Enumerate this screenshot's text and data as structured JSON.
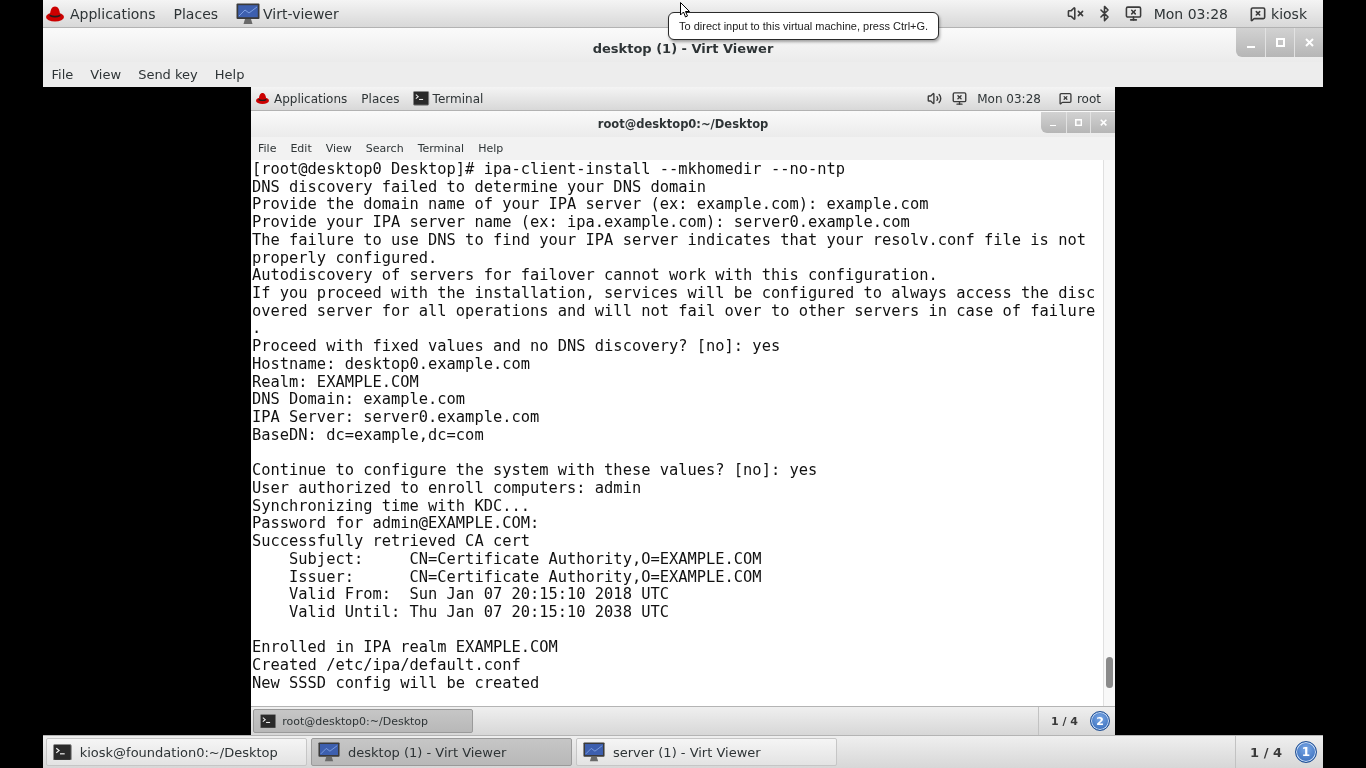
{
  "host_top_bar": {
    "menus": [
      "Applications",
      "Places"
    ],
    "app": {
      "kind": "viewer",
      "label": "Virt-viewer"
    },
    "clock": "Mon 03:28",
    "user": "kiosk"
  },
  "tooltip": {
    "text": "To direct input to this virtual machine, press Ctrl+G."
  },
  "viewer_window": {
    "title": "desktop (1) - Virt Viewer",
    "menu": [
      "File",
      "View",
      "Send key",
      "Help"
    ]
  },
  "guest": {
    "top_bar": {
      "menus": [
        "Applications",
        "Places"
      ],
      "app": {
        "kind": "terminal",
        "label": "Terminal"
      },
      "clock": "Mon 03:28",
      "user": "root"
    },
    "terminal_window": {
      "title": "root@desktop0:~/Desktop",
      "menu": [
        "File",
        "Edit",
        "View",
        "Search",
        "Terminal",
        "Help"
      ],
      "output": [
        [
          "[root@desktop0 Desktop]# ipa-client-install --mkhomedir --no-ntp",
          "DNS discovery failed to determine your DNS domain",
          "Provide the domain name of your IPA server (ex: example.com): example.com",
          "Provide your IPA server name (ex: ipa.example.com): server0.example.com",
          "The failure to use DNS to find your IPA server indicates that your resolv.conf file is not",
          "properly configured.",
          "Autodiscovery of servers for failover cannot work with this configuration.",
          "If you proceed with the installation, services will be configured to always access the disc",
          "overed server for all operations and will not fail over to other servers in case of failure",
          ".",
          "Proceed with fixed values and no DNS discovery? [no]: yes",
          "Hostname: desktop0.example.com",
          "Realm: EXAMPLE.COM",
          "DNS Domain: example.com",
          "IPA Server: server0.example.com",
          "BaseDN: dc=example,dc=com"
        ],
        [
          "Continue to configure the system with these values? [no]: yes",
          "User authorized to enroll computers: admin",
          "Synchronizing time with KDC...",
          "Password for admin@EXAMPLE.COM:",
          "Successfully retrieved CA cert",
          "    Subject:     CN=Certificate Authority,O=EXAMPLE.COM",
          "    Issuer:      CN=Certificate Authority,O=EXAMPLE.COM",
          "    Valid From:  Sun Jan 07 20:15:10 2018 UTC",
          "    Valid Until: Thu Jan 07 20:15:10 2038 UTC"
        ],
        [
          "Enrolled in IPA realm EXAMPLE.COM",
          "Created /etc/ipa/default.conf",
          "New SSSD config will be created"
        ]
      ]
    },
    "taskbar": {
      "items": [
        {
          "kind": "terminal",
          "label": "root@desktop0:~/Desktop",
          "selected": true
        }
      ],
      "pager": "1 / 4",
      "workspace": "2"
    }
  },
  "host_taskbar": {
    "items": [
      {
        "kind": "terminal",
        "label": "kiosk@foundation0:~/Desktop",
        "selected": false
      },
      {
        "kind": "viewer",
        "label": "desktop (1) - Virt Viewer",
        "selected": true
      },
      {
        "kind": "viewer",
        "label": "server (1) - Virt Viewer",
        "selected": false
      }
    ],
    "pager": "1 / 4",
    "workspace": "1"
  }
}
